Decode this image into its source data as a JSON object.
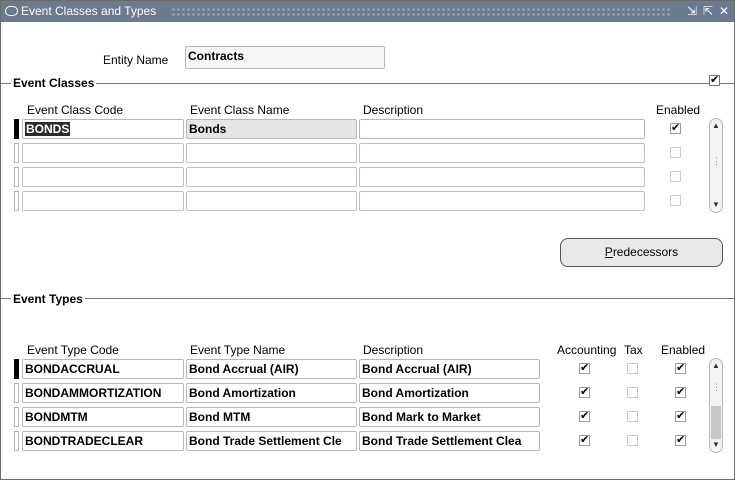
{
  "window": {
    "title": "Event Classes and Types"
  },
  "entity": {
    "label": "Entity Name",
    "value": "Contracts"
  },
  "event_classes": {
    "section_title": "Event Classes",
    "columns": {
      "code": "Event Class Code",
      "name": "Event Class Name",
      "description": "Description",
      "enabled": "Enabled"
    },
    "rows": [
      {
        "code": "BONDS",
        "name": "Bonds",
        "description": "",
        "enabled": true
      },
      {
        "code": "",
        "name": "",
        "description": "",
        "enabled": false
      },
      {
        "code": "",
        "name": "",
        "description": "",
        "enabled": false
      },
      {
        "code": "",
        "name": "",
        "description": "",
        "enabled": false
      }
    ],
    "section_checkbox": true
  },
  "predecessors_button": {
    "label_prefix": "",
    "mnemonic": "P",
    "label_rest": "redecessors"
  },
  "event_types": {
    "section_title": "Event Types",
    "columns": {
      "code": "Event Type Code",
      "name": "Event Type Name",
      "description": "Description",
      "accounting": "Accounting",
      "tax": "Tax",
      "enabled": "Enabled"
    },
    "rows": [
      {
        "code": "BONDACCRUAL",
        "name": "Bond Accrual (AIR)",
        "description": "Bond Accrual (AIR)",
        "accounting": true,
        "tax": false,
        "enabled": true
      },
      {
        "code": "BONDAMMORTIZATION",
        "name": "Bond Amortization",
        "description": "Bond Amortization",
        "accounting": true,
        "tax": false,
        "enabled": true
      },
      {
        "code": "BONDMTM",
        "name": "Bond MTM",
        "description": "Bond Mark to Market",
        "accounting": true,
        "tax": false,
        "enabled": true
      },
      {
        "code": "BONDTRADECLEAR",
        "name": "Bond Trade Settlement Cle",
        "description": "Bond Trade Settlement Clea",
        "accounting": true,
        "tax": false,
        "enabled": true
      }
    ]
  },
  "icons": {
    "check": "✔"
  }
}
